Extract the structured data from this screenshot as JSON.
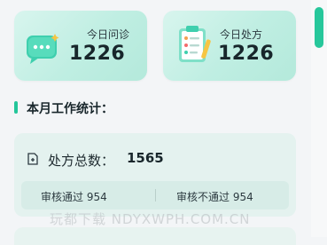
{
  "cards": [
    {
      "label": "今日问诊",
      "value": "1226"
    },
    {
      "label": "今日处方",
      "value": "1226"
    }
  ],
  "section": {
    "title": "本月工作统计："
  },
  "stats": {
    "total_label": "处方总数：",
    "total_value": "1565",
    "approved": "审核通过 954",
    "rejected": "审核不通过 954"
  },
  "watermark": "玩都下载  NDYXWPH.COM.CN",
  "colors": {
    "accent": "#23c69a",
    "card_bg": "#c6f0e4",
    "stat_bg": "#e4f2ef"
  }
}
